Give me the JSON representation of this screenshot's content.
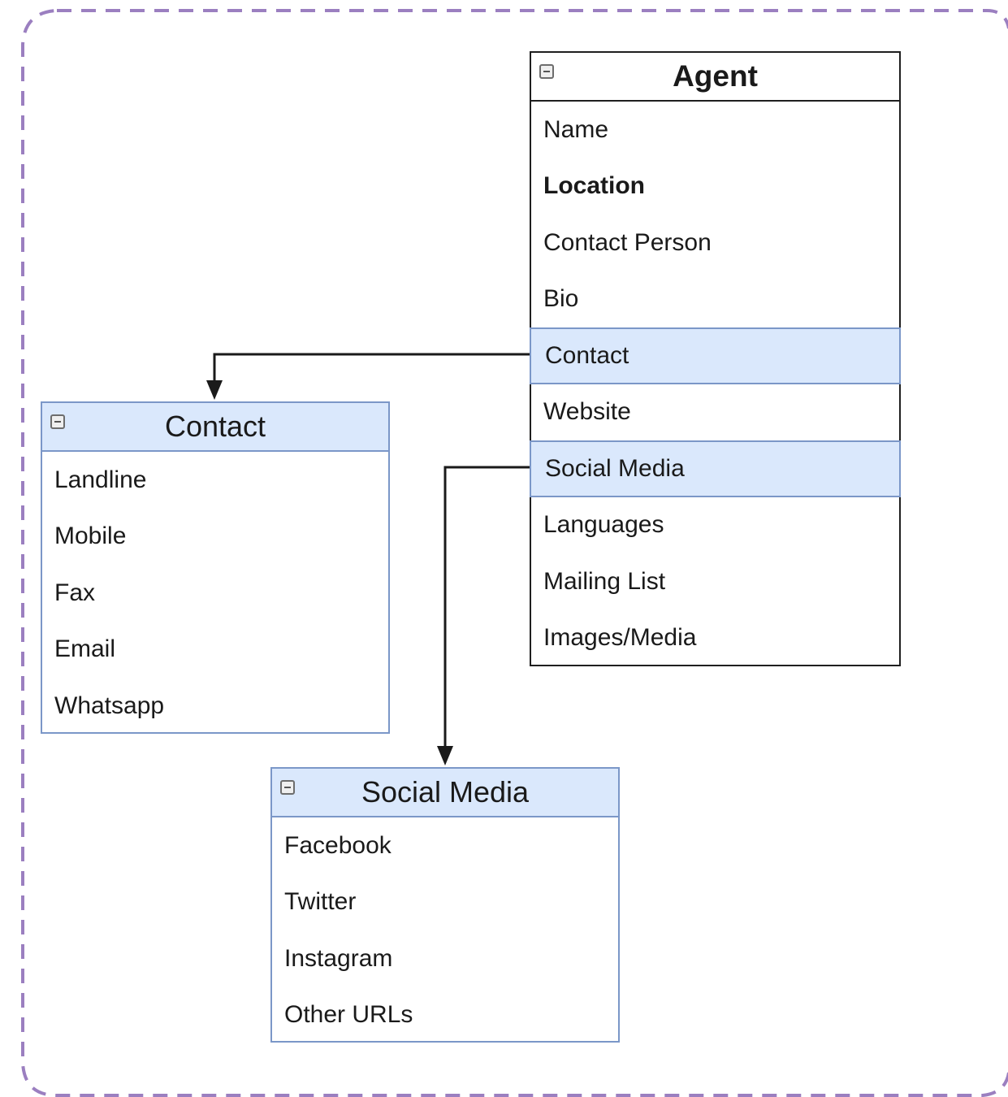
{
  "colors": {
    "frame_border": "#9b7fc0",
    "entity_blue_fill": "#dae8fc",
    "entity_blue_border": "#7b97c8",
    "entity_black_border": "#1f1f1f",
    "connector": "#1a1a1a"
  },
  "agent": {
    "title": "Agent",
    "fields": [
      "Name",
      "Location",
      "Contact Person",
      "Bio",
      "Contact",
      "Website",
      "Social Media",
      "Languages",
      "Mailing List",
      "Images/Media"
    ]
  },
  "contact": {
    "title": "Contact",
    "fields": [
      "Landline",
      "Mobile",
      "Fax",
      "Email",
      "Whatsapp"
    ]
  },
  "social_media": {
    "title": "Social Media",
    "fields": [
      "Facebook",
      "Twitter",
      "Instagram",
      "Other URLs"
    ]
  }
}
